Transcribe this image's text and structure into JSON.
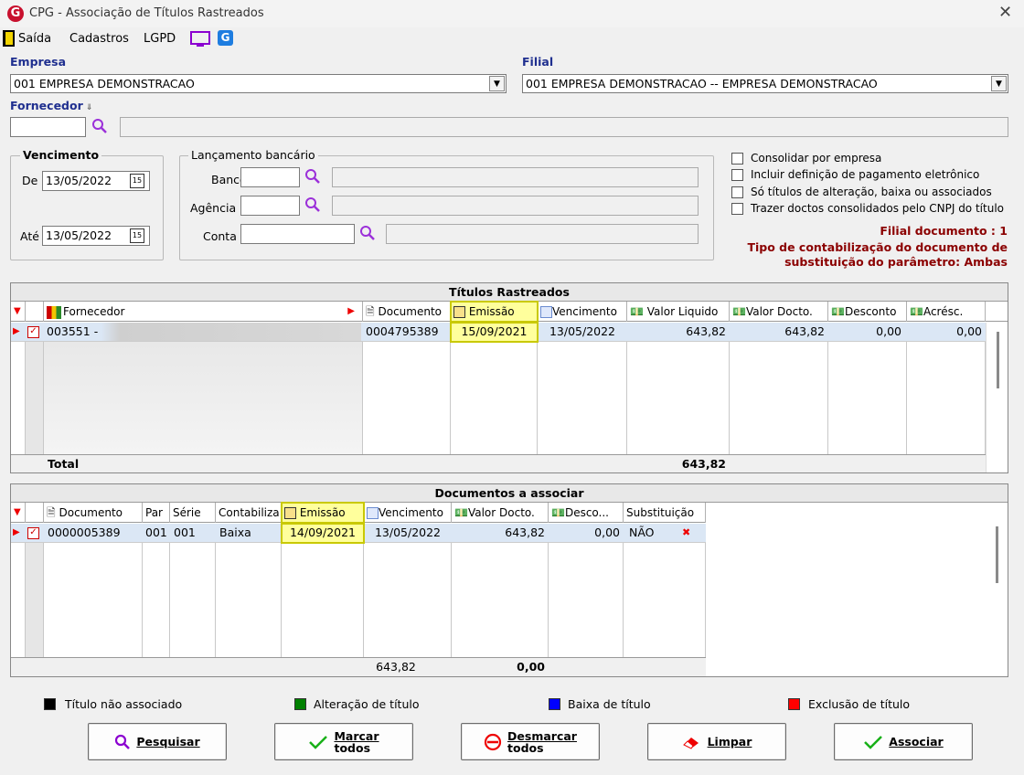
{
  "window": {
    "title": "CPG - Associação de Títulos Rastreados",
    "logo": "G",
    "close": "✕"
  },
  "menu": {
    "saida": "Saída",
    "cadastros": "Cadastros",
    "lgpd": "LGPD",
    "g_icon": "G"
  },
  "empresa": {
    "label": "Empresa",
    "value": "001 EMPRESA DEMONSTRACAO"
  },
  "filial": {
    "label": "Filial",
    "value": "001 EMPRESA DEMONSTRACAO -- EMPRESA DEMONSTRACAO"
  },
  "fornecedor": {
    "label": "Fornecedor",
    "value": "",
    "name": ""
  },
  "vencimento": {
    "legend": "Vencimento",
    "de_label": "De",
    "de_value": "13/05/2022",
    "ate_label": "Até",
    "ate_value": "13/05/2022",
    "cal": "15"
  },
  "lancamento": {
    "legend": "Lançamento bancário",
    "banco_label": "Banco",
    "agencia_label": "Agência",
    "conta_label": "Conta",
    "banco": "",
    "agencia": "",
    "conta": ""
  },
  "options": [
    "Consolidar por empresa",
    "Incluir definição de pagamento eletrônico",
    "Só títulos de alteração, baixa ou associados",
    "Trazer doctos consolidados pelo CNPJ do título"
  ],
  "info": {
    "filial_doc": "Filial documento : 1",
    "tipo_line1": "Tipo de contabilização do documento de",
    "tipo_line2": "substituição do parâmetro: Ambas"
  },
  "titulos": {
    "title": "Títulos Rastreados",
    "headers": {
      "fornecedor": "Fornecedor",
      "documento": "Documento",
      "emissao": "Emissão",
      "vencimento": "Vencimento",
      "valor_liquido": "Valor Liquido",
      "valor_docto": "Valor Docto.",
      "desconto": "Desconto",
      "acresc": "Acrésc."
    },
    "row": {
      "fornecedor": "003551 -",
      "documento": "0004795389",
      "emissao": "15/09/2021",
      "vencimento": "13/05/2022",
      "valor_liquido": "643,82",
      "valor_docto": "643,82",
      "desconto": "0,00",
      "acresc": "0,00"
    },
    "total_label": "Total",
    "total_value": "643,82"
  },
  "documentos": {
    "title": "Documentos a associar",
    "headers": {
      "documento": "Documento",
      "par": "Par",
      "serie": "Série",
      "contabiliza": "Contabiliza",
      "emissao": "Emissão",
      "vencimento": "Vencimento",
      "valor_docto": "Valor Docto.",
      "desconto": "Desco...",
      "substituicao": "Substituição"
    },
    "row": {
      "documento": "0000005389",
      "par": "001",
      "serie": "001",
      "contabiliza": "Baixa",
      "emissao": "14/09/2021",
      "vencimento": "13/05/2022",
      "valor_docto": "643,82",
      "desconto": "0,00",
      "substituicao": "NÃO",
      "x": "✖"
    },
    "total_valor": "643,82",
    "total_desc": "0,00"
  },
  "legend": [
    {
      "label": "Título não associado",
      "color": "#000000"
    },
    {
      "label": "Alteração de título",
      "color": "#008000"
    },
    {
      "label": "Baixa de título",
      "color": "#0000ff"
    },
    {
      "label": "Exclusão de título",
      "color": "#ff0000"
    }
  ],
  "buttons": {
    "pesquisar": "Pesquisar",
    "marcar1": "Marcar",
    "marcar2": "todos",
    "desmarcar1": "Desmarcar",
    "desmarcar2": "todos",
    "limpar": "Limpar",
    "associar": "Associar"
  }
}
